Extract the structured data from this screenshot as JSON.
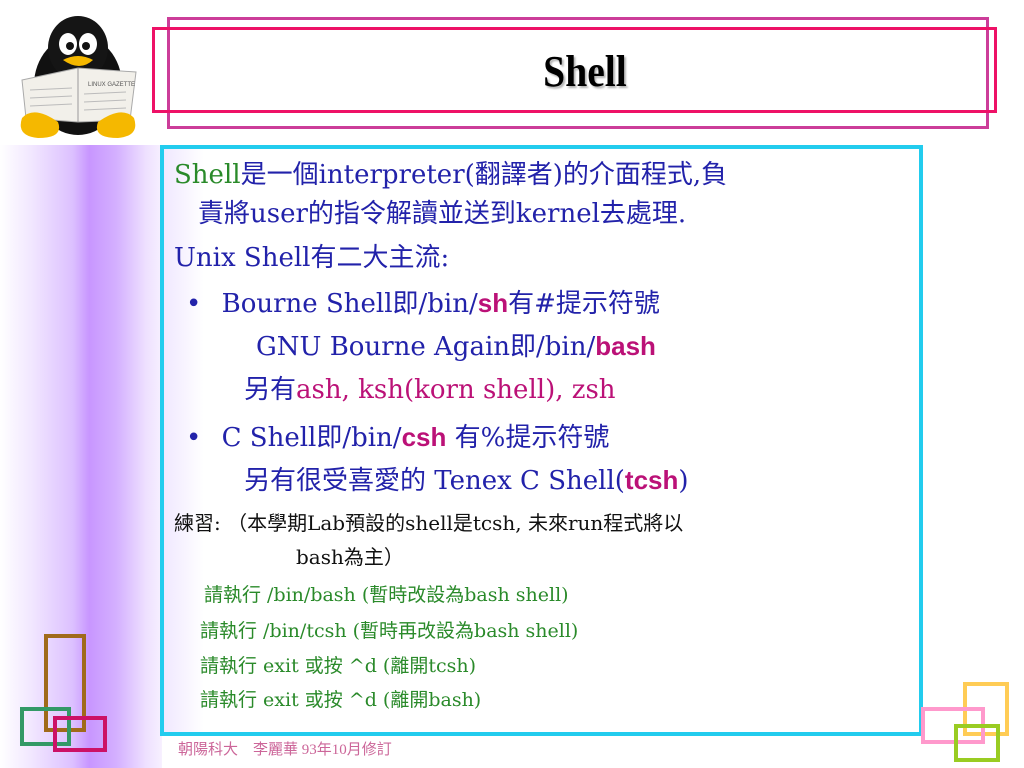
{
  "slide": {
    "title": "Shell",
    "logo": "linux-penguin-reading-newspaper",
    "newspaper_caption": "LINUX GAZETTE",
    "content": {
      "line1": {
        "highlight": "Shell",
        "text": "是一個interpreter(翻譯者)的介面程式,負"
      },
      "line2": {
        "text": "責將user的指令解讀並送到kernel去處理."
      },
      "line3": {
        "text": "Unix Shell有二大主流:"
      },
      "line4": {
        "bullet": "•",
        "pre": "Bourne Shell即/bin/",
        "emph": "sh",
        "post": "有#提示符號"
      },
      "line5": {
        "pre": "GNU Bourne Again即/bin/",
        "emph": "bash"
      },
      "line6": {
        "pre": "另有",
        "emph": "ash, ksh(korn shell), zsh"
      },
      "line7": {
        "bullet": "•",
        "pre": "C Shell即/bin/",
        "emph": "csh",
        "post": " 有%提示符號"
      },
      "line8": {
        "pre": "另有很受喜愛的 Tenex C Shell(",
        "emph": "tcsh",
        "post": ")"
      },
      "line9": {
        "text": "練習: （本學期Lab預設的shell是tcsh, 未來run程式將以"
      },
      "line10": {
        "text": "bash為主）"
      },
      "exercises": [
        "請執行 /bin/bash (暫時改設為bash shell)",
        "請執行 /bin/tcsh (暫時再改設為bash shell)",
        "請執行 exit 或按 ^d (離開tcsh)",
        "請執行 exit 或按 ^d (離開bash)"
      ]
    },
    "footer": "朝陽科大　李麗華 93年10月修訂"
  },
  "colors": {
    "title_frame_outer": "#cc3d99",
    "title_frame_inner": "#ee1166",
    "content_border": "#22ccee",
    "body_text": "#2222aa",
    "highlight_green": "#2a8a2a",
    "emphasis_magenta": "#bb1177",
    "footer_text": "#cc6699"
  }
}
